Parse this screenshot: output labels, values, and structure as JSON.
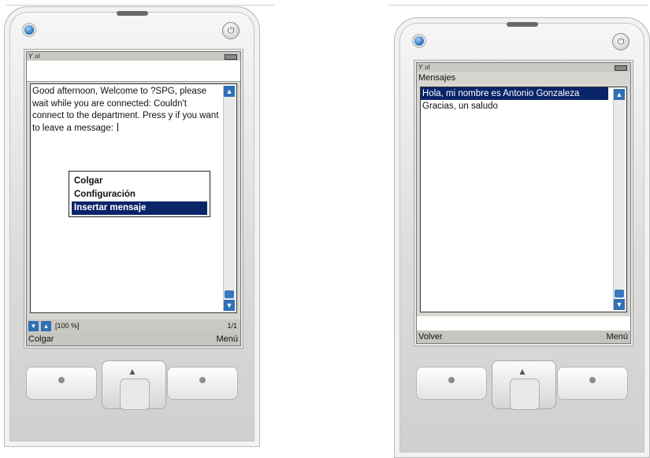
{
  "left_phone": {
    "message_text": "  Good afternoon, Welcome to ?SPG, please wait while you are connected: Couldn't connect to the department. Press y if you want to leave a message: ",
    "menu_items": [
      {
        "label": "Colgar"
      },
      {
        "label": "Configuración"
      },
      {
        "label": "Insertar mensaje"
      }
    ],
    "zoom_text": "[100 %]",
    "page_indicator": "1/1",
    "softkey_left": "Colgar",
    "softkey_right": "Menú"
  },
  "right_phone": {
    "title": "Mensajes",
    "messages": [
      {
        "text": "Hola, mi nombre es Antonio Gonzaleza"
      },
      {
        "text": "Gracias, un saludo"
      }
    ],
    "softkey_left": "Volver",
    "softkey_right": "Menú"
  },
  "icons": {
    "signal": "signal-strength-icon",
    "battery": "battery-icon",
    "scroll_up": "scroll-up-arrow-icon",
    "scroll_down": "scroll-down-arrow-icon",
    "power": "power-icon",
    "dpad_up": "dpad-up-arrow-icon"
  },
  "colors": {
    "selection": "#0a2468",
    "scroll_accent": "#2f6fb5",
    "led": "#3d7fc5"
  }
}
